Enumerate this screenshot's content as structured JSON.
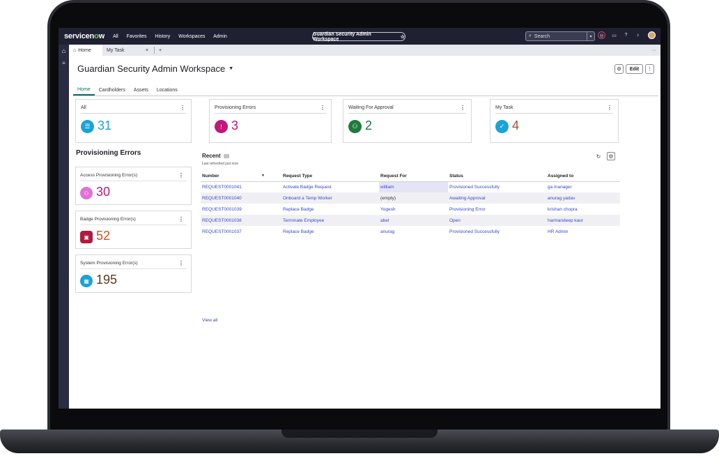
{
  "brand": {
    "logo_prefix": "servicen",
    "logo_o": "o",
    "logo_suffix": "w"
  },
  "top_nav": [
    "All",
    "Favorites",
    "History",
    "Workspaces",
    "Admin"
  ],
  "workspace_pill": {
    "label": "Guardian Security Admin Workspace",
    "star": "☆"
  },
  "search": {
    "placeholder": "Search"
  },
  "page_tabs": [
    {
      "label": "Home"
    },
    {
      "label": "My Task"
    }
  ],
  "header": {
    "title": "Guardian Security Admin Workspace",
    "edit_label": "Edit"
  },
  "sub_tabs": [
    "Home",
    "Cardholders",
    "Assets",
    "Locations"
  ],
  "kpi_cards": [
    {
      "label": "All",
      "value": "31",
      "icon": "list-check-icon",
      "color": "#1aa3d4"
    },
    {
      "label": "Provisioning Errors",
      "value": "3",
      "icon": "alert-circle-icon",
      "color": "#c2187a"
    },
    {
      "label": "Waiting For Approval",
      "value": "2",
      "icon": "badge-icon",
      "color": "#1f7a3b"
    },
    {
      "label": "My Task",
      "value": "4",
      "icon": "calendar-check-icon",
      "color": "#1aa3d4"
    }
  ],
  "provisioning": {
    "title": "Provisioning Errors",
    "cards": [
      {
        "label": "Access Provisioning Error(s)",
        "value": "30",
        "icon": "badge-icon",
        "color": "#e36fd8"
      },
      {
        "label": "Badge Provisioning Error(s)",
        "value": "52",
        "icon": "id-card-icon",
        "color": "#b3193e"
      },
      {
        "label": "System Provisioning Error(s)",
        "value": "195",
        "icon": "grid-icon",
        "color": "#1aa3d4"
      }
    ]
  },
  "recent": {
    "title": "Recent",
    "subtitle": "Last refreshed just now",
    "columns": [
      "Number",
      "Request Type",
      "Request For",
      "Status",
      "Assigned to"
    ],
    "rows": [
      {
        "number": "REQUEST0001041",
        "type": "Activate Badge Request",
        "for": "william",
        "status": "Provisioned Successfully",
        "assigned": "ga manager"
      },
      {
        "number": "REQUEST0001040",
        "type": "Onboard a Temp Worker",
        "for": "(empty)",
        "status": "Awaiting Approval",
        "assigned": "anurag yadav"
      },
      {
        "number": "REQUEST0001039",
        "type": "Replace Badge",
        "for": "Yogesh",
        "status": "Provisioning  Error",
        "assigned": "krishan chopra"
      },
      {
        "number": "REQUEST0001038",
        "type": "Terminate Employee",
        "for": "abel",
        "status": "Open",
        "assigned": "harmandeep kaur"
      },
      {
        "number": "REQUEST0001037",
        "type": "Replace Badge",
        "for": "anurag",
        "status": "Provisioned Successfully",
        "assigned": "HR Admin"
      }
    ],
    "view_all": "View all"
  }
}
